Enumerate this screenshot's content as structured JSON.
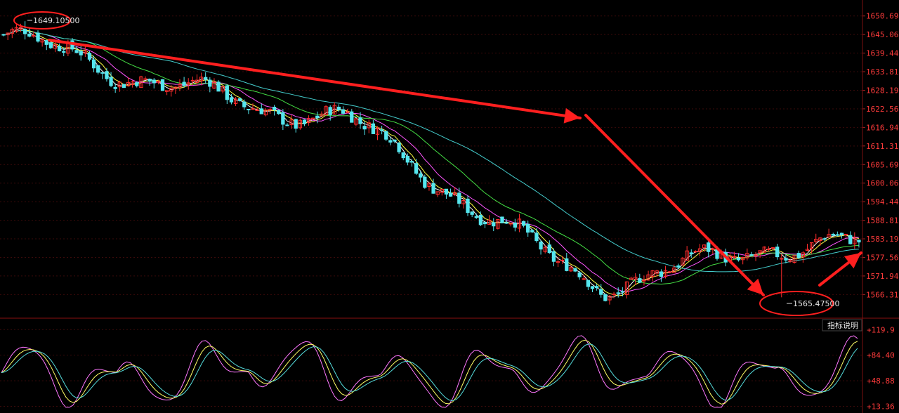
{
  "colors": {
    "background": "#000000",
    "up": "#ff2d2d",
    "down": "#55e6ee",
    "grid": "#3a0a0a",
    "axis_text": "#ff3b3b",
    "arrow": "#ff1f1f",
    "ma": [
      "#ffffff",
      "#ffff44",
      "#ff55ff",
      "#44dd44",
      "#44cccc"
    ],
    "osc": [
      "#ff77ff",
      "#ffff66",
      "#55dddd"
    ]
  },
  "indicator_button_label": "指标说明",
  "chart_data": [
    {
      "type": "candlestick",
      "y_axis_ticks": [
        {
          "value": 1650.691,
          "label": "1650.691"
        },
        {
          "value": 1645.066,
          "label": "1645.066"
        },
        {
          "value": 1639.44,
          "label": "1639.44"
        },
        {
          "value": 1633.81,
          "label": "1633.81"
        },
        {
          "value": 1628.191,
          "label": "1628.191"
        },
        {
          "value": 1622.567,
          "label": "1622.567"
        },
        {
          "value": 1616.942,
          "label": "1616.942"
        },
        {
          "value": 1611.317,
          "label": "1611.317"
        },
        {
          "value": 1605.692,
          "label": "1605.692"
        },
        {
          "value": 1600.067,
          "label": "1600.067"
        },
        {
          "value": 1594.442,
          "label": "1594.442"
        },
        {
          "value": 1588.818,
          "label": "1588.818"
        },
        {
          "value": 1583.193,
          "label": "1583.193"
        },
        {
          "value": 1577.568,
          "label": "1577.568"
        },
        {
          "value": 1571.943,
          "label": "1571.943"
        },
        {
          "value": 1566.318,
          "label": "1566.318"
        }
      ],
      "ylim": [
        1561.5,
        1653.4
      ],
      "annotations": {
        "max_label": "1649.10500",
        "min_label": "1565.47500",
        "max_value": 1649.105,
        "min_value": 1565.475
      },
      "trend_path": [
        1645.0,
        1641.0,
        1637.0,
        1633.0,
        1629.5,
        1626.0,
        1622.8,
        1621.5,
        1620.0,
        1611.0,
        1602.0,
        1593.0,
        1584.0,
        1575.0,
        1569.5,
        1571.5,
        1575.0,
        1578.0,
        1581.0,
        1581.5,
        1581.0
      ],
      "n_candles": 200
    },
    {
      "type": "line",
      "y_axis_ticks": [
        {
          "value": 119.9,
          "label": "+119.9"
        },
        {
          "value": 84.4,
          "label": "+84.40"
        },
        {
          "value": 48.88,
          "label": "+48.88"
        },
        {
          "value": 13.36,
          "label": "+13.36"
        }
      ],
      "ylim": [
        8,
        127
      ]
    }
  ]
}
